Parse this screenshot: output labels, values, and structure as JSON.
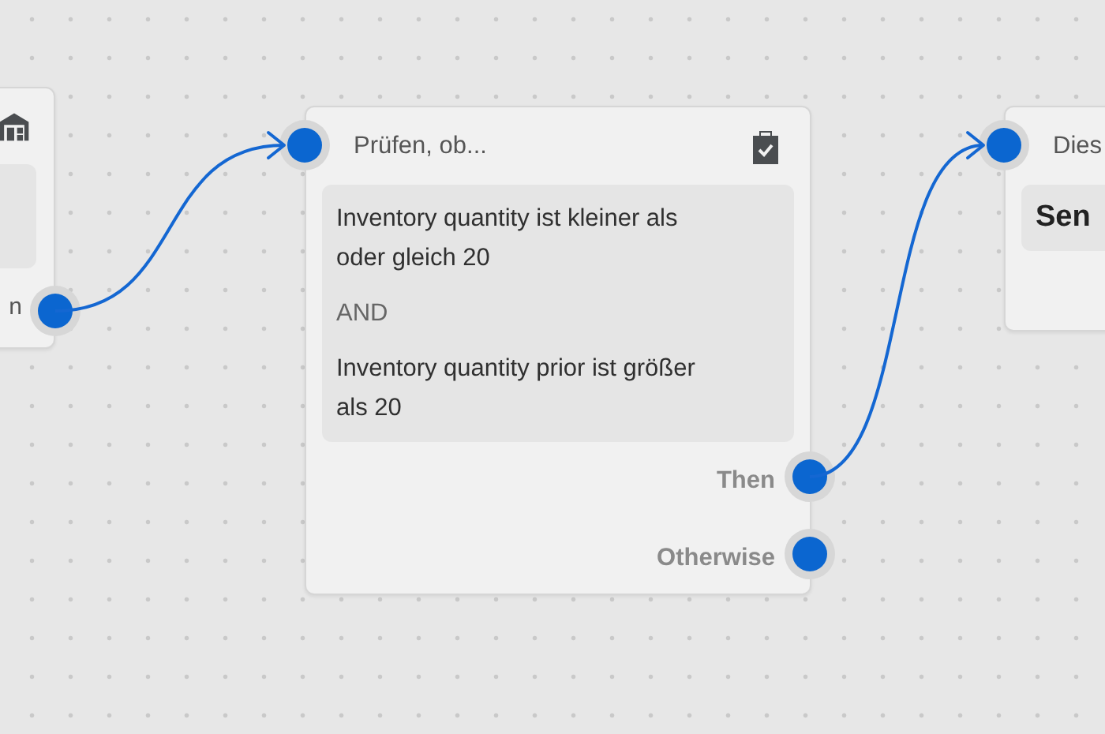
{
  "canvas": {
    "nodes": [
      {
        "kind": "source",
        "outputs": [
          {
            "label": "n",
            "connected": true
          }
        ]
      },
      {
        "kind": "condition",
        "title": "Prüfen, ob...",
        "conditions": [
          "Inventory quantity ist kleiner als oder gleich 20",
          "Inventory quantity prior ist größer als 20"
        ],
        "operator": "AND",
        "outputs": [
          {
            "label": "Then",
            "connected": true
          },
          {
            "label": "Otherwise"
          }
        ]
      },
      {
        "kind": "action",
        "title": "Dies",
        "action": "Sen"
      }
    ]
  }
}
